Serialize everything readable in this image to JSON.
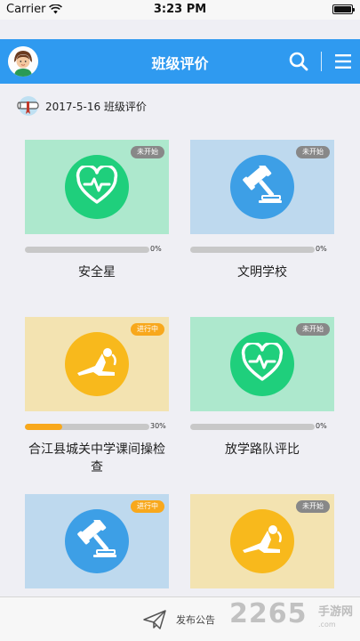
{
  "status_bar": {
    "carrier": "Carrier",
    "time": "3:23 PM"
  },
  "header": {
    "title": "班级评价",
    "color": "#2f9af0"
  },
  "date_label": "2017-5-16 班级评价",
  "cards": [
    {
      "name": "安全星",
      "status": "未开始",
      "progress": "0%",
      "progress_value": 0,
      "icon": "heart-pulse-icon",
      "tile_color": "#ade8cd",
      "icon_color": "#1fcf7c"
    },
    {
      "name": "文明学校",
      "status": "未开始",
      "progress": "0%",
      "progress_value": 0,
      "icon": "gavel-icon",
      "tile_color": "#bed9ee",
      "icon_color": "#3d9fe6"
    },
    {
      "name": "合江县城关中学课间操检查",
      "status": "进行中",
      "progress": "30%",
      "progress_value": 0.3,
      "icon": "exercise-icon",
      "tile_color": "#f3e3b1",
      "icon_color": "#f8b91c"
    },
    {
      "name": "放学路队评比",
      "status": "未开始",
      "progress": "0%",
      "progress_value": 0,
      "icon": "heart-pulse-icon",
      "tile_color": "#ade8cd",
      "icon_color": "#1fcf7c"
    },
    {
      "name": "",
      "status": "进行中",
      "icon": "gavel-icon",
      "tile_color": "#bed9ee",
      "icon_color": "#3d9fe6"
    },
    {
      "name": "",
      "status": "未开始",
      "icon": "exercise-icon",
      "tile_color": "#f3e3b1",
      "icon_color": "#f8b91c"
    }
  ],
  "bottom_bar": {
    "publish_label": "发布公告"
  },
  "watermark": {
    "number": "2265",
    "suffix": "手游网",
    "url": ".com"
  }
}
